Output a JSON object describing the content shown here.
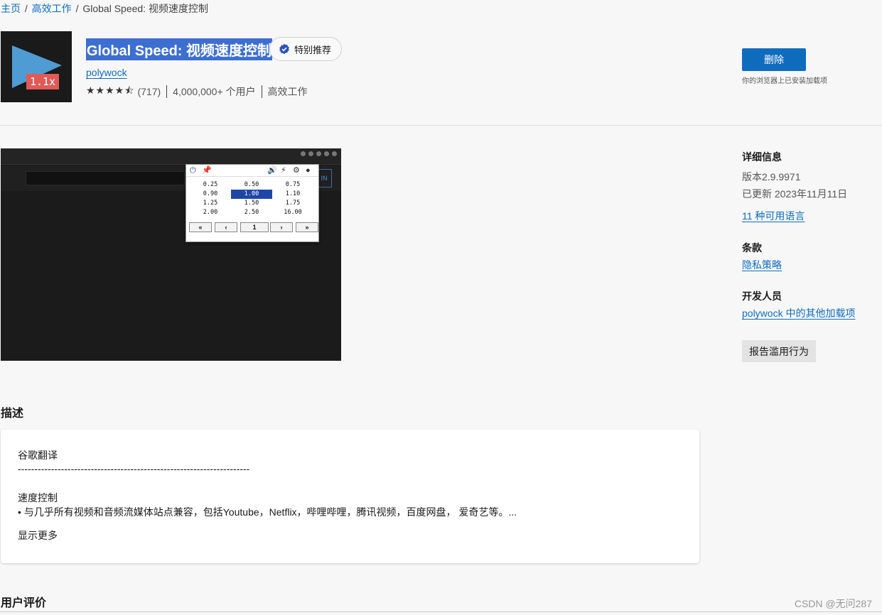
{
  "breadcrumb": {
    "home": "主页",
    "sep1": "/",
    "category": "高效工作",
    "sep2": "/",
    "current": "Global Speed: 视频速度控制"
  },
  "extension": {
    "logo_text": "1.1x",
    "title": "Global Speed: 视频速度控制",
    "badge": "特别推荐",
    "author": "polywock",
    "stars": "★★★★⯪",
    "rating_count": "(717)",
    "users": "4,000,000+ 个用户",
    "category": "高效工作"
  },
  "actions": {
    "remove_label": "删除",
    "installed_note": "你的浏览器上已安装加载项"
  },
  "screenshot": {
    "signin": "IN",
    "speeds": [
      [
        "0.25",
        "0.50",
        "0.75"
      ],
      [
        "0.90",
        "1.00",
        "1.10"
      ],
      [
        "1.25",
        "1.50",
        "1.75"
      ],
      [
        "2.00",
        "2.50",
        "16.00"
      ]
    ],
    "selected": "1.00",
    "controls": [
      "«",
      "‹",
      "1",
      "›",
      "»"
    ]
  },
  "sidebar": {
    "details_heading": "详细信息",
    "version": "版本2.9.9971",
    "updated": "已更新 2023年11月11日",
    "languages_link": "11 种可用语言",
    "terms_heading": "条款",
    "privacy_link": "隐私策略",
    "developer_heading": "开发人员",
    "more_addons_link": "polywock 中的其他加载项",
    "report_label": "报告滥用行为"
  },
  "description": {
    "heading": "描述",
    "line1": "谷歌翻译",
    "line2": "----------------------------------------------------------------------",
    "line3": "速度控制",
    "line4": "• 与几乎所有视频和音频流媒体站点兼容，包括Youtube，Netflix，哔哩哔哩，腾讯视频，百度网盘， 爱奇艺等。...",
    "show_more": "显示更多"
  },
  "reviews": {
    "heading": "用户评价"
  },
  "watermark": "CSDN @无问287",
  "colors": {
    "accent": "#0f6cbd",
    "title_highlight": "#3d6fd1",
    "logo_play": "#4f9bd3",
    "logo_badge": "#e05a57"
  }
}
